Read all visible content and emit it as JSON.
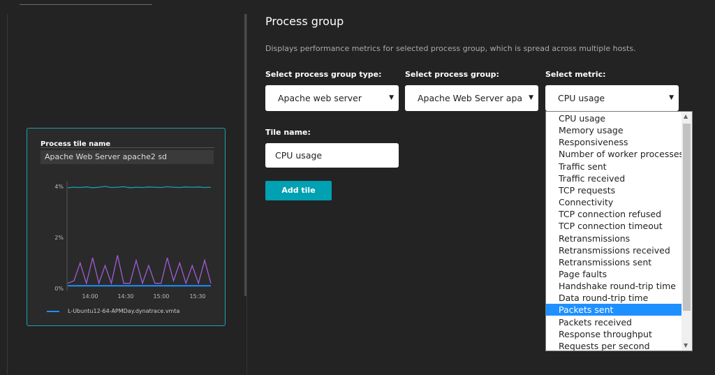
{
  "tile": {
    "heading": "Process tile name",
    "name_value": "Apache Web Server apache2 sd",
    "legend_label": "L-Ubuntu12-64-APMDay.dynatrace.vmta"
  },
  "panel": {
    "title": "Process group",
    "description": "Displays performance metrics for selected process group, which is spread across multiple hosts.",
    "group_type_label": "Select process group type:",
    "group_type_value": "Apache web server",
    "group_label": "Select process group:",
    "group_value": "Apache Web Server apa",
    "metric_label": "Select metric:",
    "metric_value": "CPU usage",
    "tile_name_label": "Tile name:",
    "tile_name_value": "CPU usage",
    "add_button": "Add tile"
  },
  "metric_options": [
    "CPU usage",
    "Memory usage",
    "Responsiveness",
    "Number of worker processes",
    "Traffic sent",
    "Traffic received",
    "TCP requests",
    "Connectivity",
    "TCP connection refused",
    "TCP connection timeout",
    "Retransmissions",
    "Retransmissions received",
    "Retransmissions sent",
    "Page faults",
    "Handshake round-trip time",
    "Data round-trip time",
    "Packets sent",
    "Packets received",
    "Response throughput",
    "Requests per second"
  ],
  "highlighted_option": "Packets sent",
  "chart_data": {
    "type": "line",
    "y_ticks": [
      "4%",
      "2%",
      "0%"
    ],
    "x_ticks": [
      "14:00",
      "14:30",
      "15:00",
      "15:30"
    ],
    "ylim": [
      0,
      4
    ],
    "series": [
      {
        "color": "#1aa0b0",
        "values": [
          3.95,
          3.97,
          3.96,
          3.98,
          3.95,
          3.97,
          4.0,
          3.96,
          3.97,
          3.99,
          3.95,
          3.97,
          3.96,
          3.98,
          3.97,
          3.96,
          3.99,
          3.97,
          3.96,
          3.98,
          3.97,
          3.98,
          3.96,
          3.97
        ]
      },
      {
        "color": "#a05cd6",
        "values": [
          0.2,
          0.3,
          1.0,
          0.2,
          1.2,
          0.2,
          0.9,
          0.2,
          1.3,
          0.2,
          0.2,
          1.1,
          0.2,
          0.9,
          0.2,
          0.2,
          1.2,
          0.3,
          1.0,
          0.2,
          0.9,
          0.2,
          1.1,
          0.2
        ]
      },
      {
        "color": "#1e90ff",
        "values": [
          0.1,
          0.1,
          0.1,
          0.1,
          0.1,
          0.1,
          0.1,
          0.1,
          0.1,
          0.1,
          0.1,
          0.1,
          0.1,
          0.1,
          0.1,
          0.1,
          0.1,
          0.1,
          0.1,
          0.1,
          0.1,
          0.1,
          0.1,
          0.1
        ]
      }
    ]
  }
}
